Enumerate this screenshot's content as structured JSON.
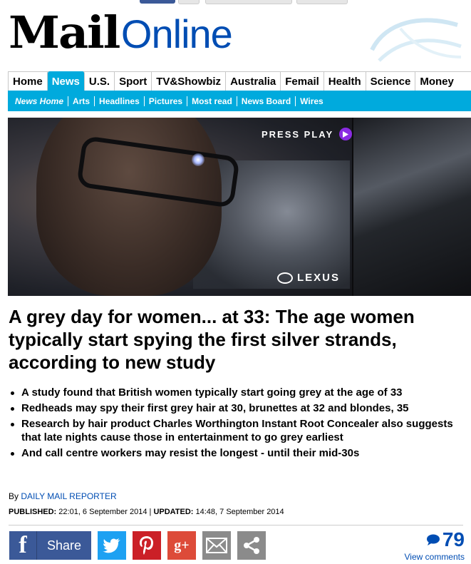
{
  "brand": {
    "mail": "Mail",
    "online": "Online"
  },
  "nav_primary": [
    {
      "label": "Home",
      "active": false
    },
    {
      "label": "News",
      "active": true
    },
    {
      "label": "U.S.",
      "active": false
    },
    {
      "label": "Sport",
      "active": false
    },
    {
      "label": "TV&Showbiz",
      "active": false
    },
    {
      "label": "Australia",
      "active": false
    },
    {
      "label": "Femail",
      "active": false
    },
    {
      "label": "Health",
      "active": false
    },
    {
      "label": "Science",
      "active": false
    },
    {
      "label": "Money",
      "active": false
    }
  ],
  "nav_secondary": [
    "News Home",
    "Arts",
    "Headlines",
    "Pictures",
    "Most read",
    "News Board",
    "Wires"
  ],
  "ad": {
    "cta": "PRESS PLAY",
    "brand": "LEXUS"
  },
  "article": {
    "headline": "A grey day for women... at 33: The age women typically start spying the first silver strands, according to new study",
    "bullets": [
      "A study found that British women typically start going grey at the age of 33",
      "Redheads may spy their first grey hair at 30, brunettes at 32 and blondes, 35",
      "Research by hair product Charles Worthington Instant Root Concealer also suggests that late nights cause those in entertainment  to go grey earliest",
      "And call centre workers may resist the longest - until their mid-30s"
    ],
    "byline_prefix": "By",
    "author": "DAILY MAIL REPORTER",
    "published_label": "PUBLISHED:",
    "published": "22:01, 6 September 2014",
    "separator": "|",
    "updated_label": "UPDATED:",
    "updated": "14:48, 7 September 2014"
  },
  "share": {
    "share_label": "Share"
  },
  "comments": {
    "count": "79",
    "label": "View comments"
  },
  "colors": {
    "nav_active": "#00aadd",
    "link": "#004db3",
    "facebook": "#3b5998",
    "twitter": "#1da1f2",
    "pinterest": "#cb2027",
    "googleplus": "#dd4b39"
  }
}
